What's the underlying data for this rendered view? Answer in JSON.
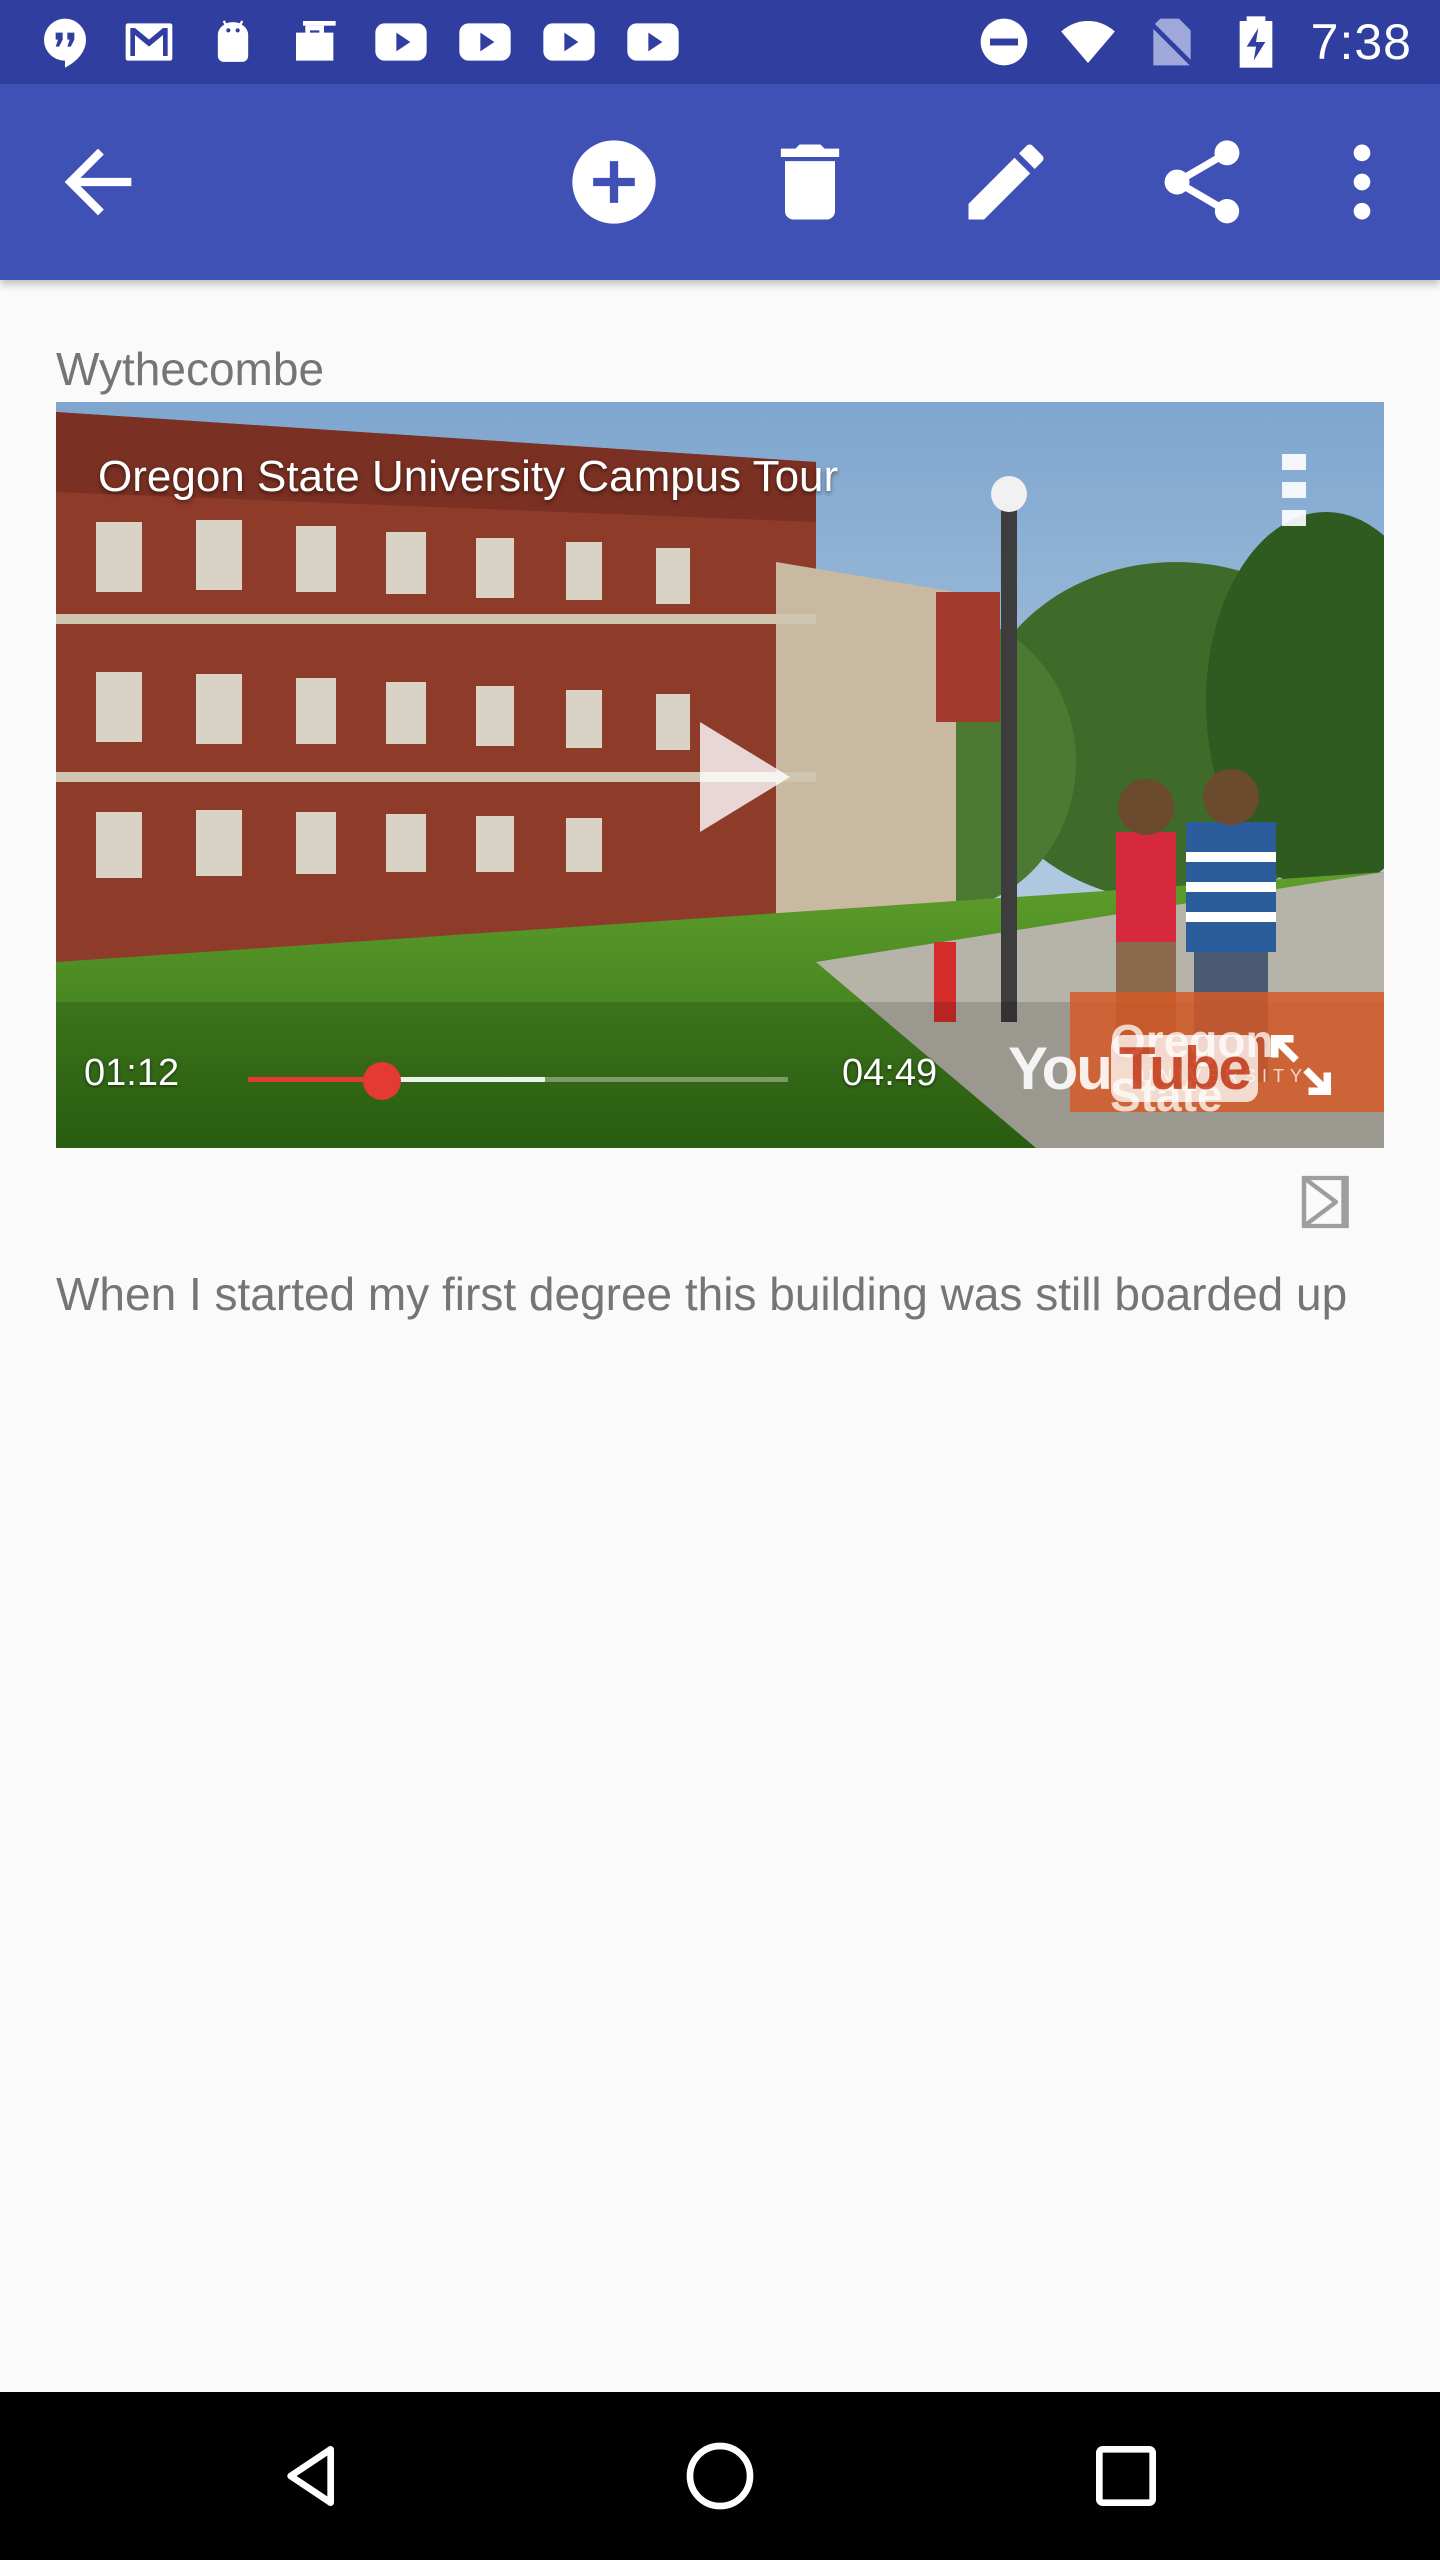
{
  "status_bar": {
    "time": "7:38",
    "left_icons": [
      "hangouts-icon",
      "gmail-icon",
      "android-icon",
      "briefcase-icon",
      "youtube-icon",
      "youtube-icon",
      "youtube-icon",
      "youtube-icon"
    ],
    "right_icons": [
      "do-not-disturb-icon",
      "wifi-icon",
      "no-sim-icon",
      "battery-charging-icon"
    ]
  },
  "app_bar": {
    "buttons": [
      "back-arrow-icon",
      "add-circle-icon",
      "delete-icon",
      "edit-icon",
      "share-icon",
      "more-vert-icon"
    ],
    "background": "#3f51b5"
  },
  "entry": {
    "place_name": "Wythecombe",
    "caption": "When I started my first degree this building was still boarded up"
  },
  "video": {
    "title": "Oregon State University Campus Tour",
    "current_time": "01:12",
    "duration": "04:49",
    "progress_fraction": 0.249,
    "buffered_fraction": 0.55,
    "watermark_brand": "YouTube",
    "watermark_you": "You",
    "watermark_tube": "Tube",
    "channel_badge": "Oregon State",
    "channel_badge_sub": "UNIVERSITY"
  },
  "colors": {
    "status_bar": "#303f9f",
    "accent_red": "#e53935",
    "text_secondary": "#757575"
  }
}
